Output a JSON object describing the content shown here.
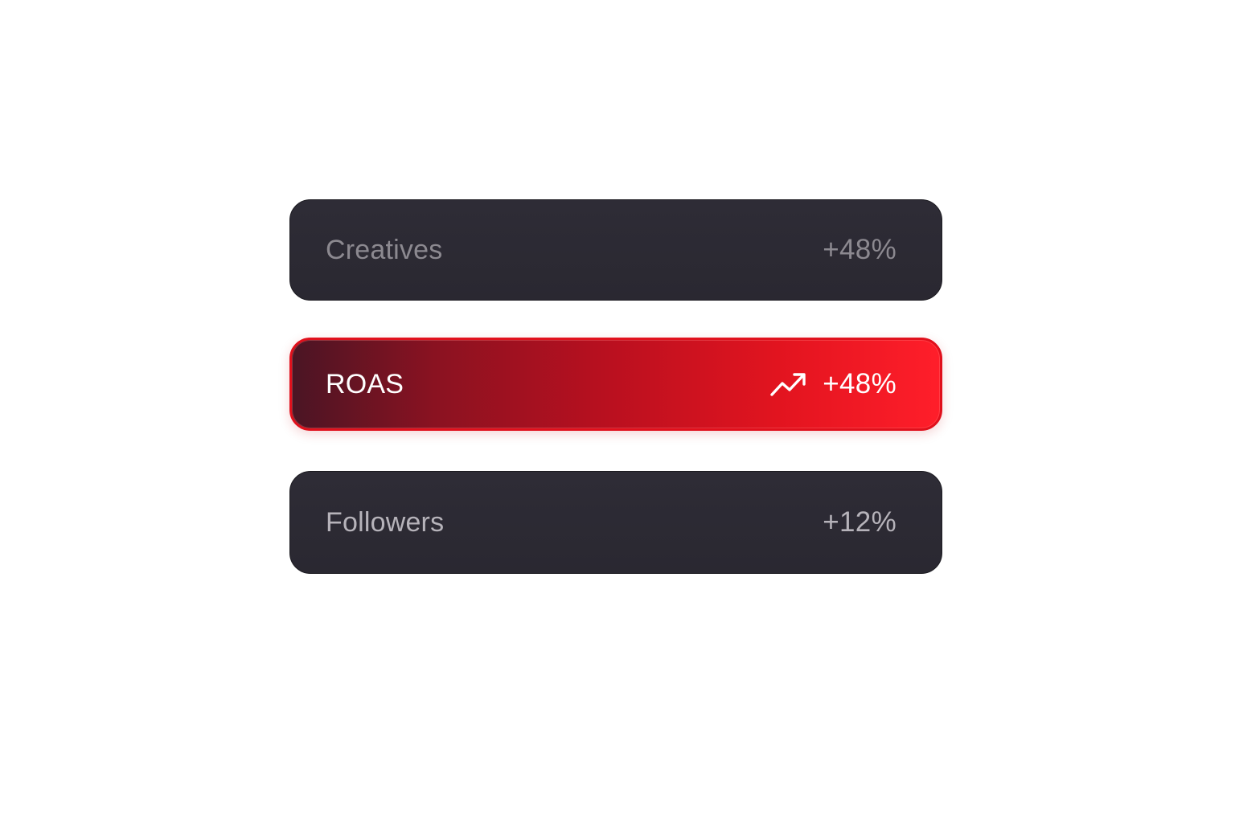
{
  "metrics": [
    {
      "label": "Creatives",
      "value": "+48%",
      "state": "inactive"
    },
    {
      "label": "ROAS",
      "value": "+48%",
      "state": "active",
      "icon": "trending-up-icon"
    },
    {
      "label": "Followers",
      "value": "+12%",
      "state": "inactive"
    }
  ],
  "colors": {
    "card_dark": "#2c2a33",
    "active_start": "#4a1524",
    "active_end": "#ff1e2a",
    "active_border": "#e0101c",
    "text_white": "#ffffff",
    "text_muted": "#8c8990"
  }
}
